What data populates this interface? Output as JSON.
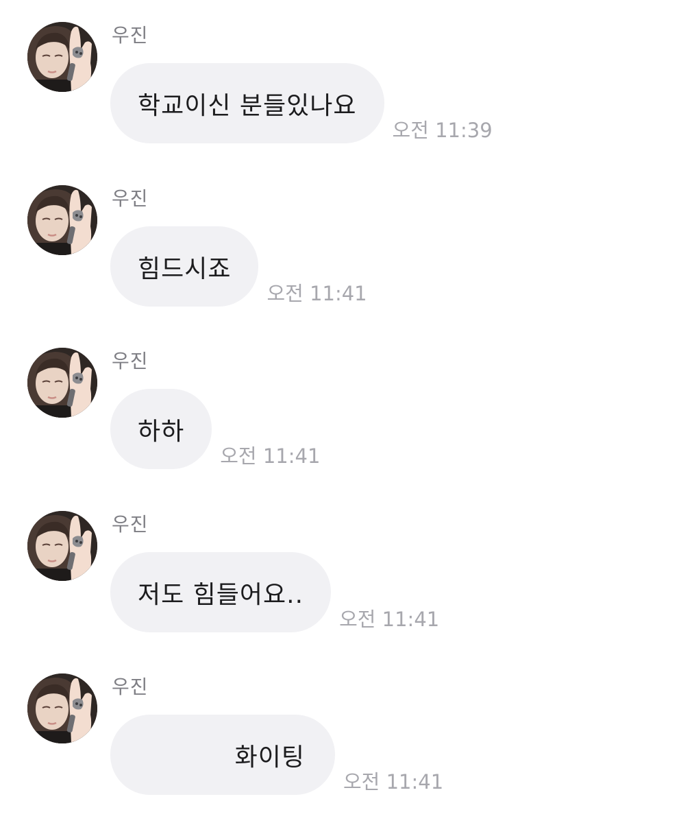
{
  "messages": [
    {
      "sender": "우진",
      "text": "학교이신 분들있나요",
      "time": "오전 11:39"
    },
    {
      "sender": "우진",
      "text": "힘드시죠",
      "time": "오전 11:41"
    },
    {
      "sender": "우진",
      "text": "하하",
      "time": "오전 11:41"
    },
    {
      "sender": "우진",
      "text": "저도 힘들어요..",
      "time": "오전 11:41"
    },
    {
      "sender": "우진",
      "text": "화이팅",
      "time": "오전 11:41"
    }
  ],
  "colors": {
    "bubble_background": "#f1f1f4",
    "sender_name": "#7e7e84",
    "timestamp": "#a7a7ad",
    "message_text": "#1c1c1e"
  }
}
